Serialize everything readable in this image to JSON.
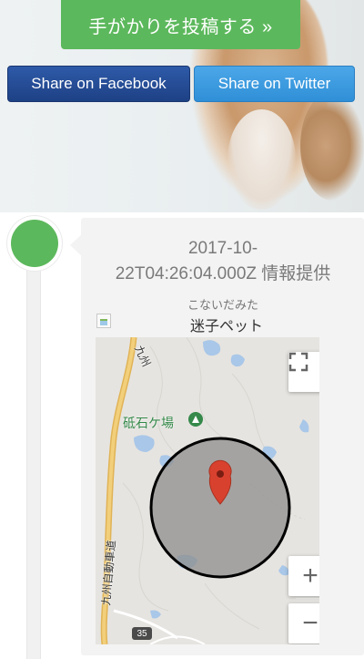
{
  "hero": {
    "post_button": "手がかりを投稿する »",
    "share_facebook": "Share on Facebook",
    "share_twitter": "Share on Twitter"
  },
  "timeline": {
    "timestamp_line1": "2017-10-",
    "timestamp_line2": "22T04:26:04.000Z 情報提供",
    "author": "こないだみた",
    "image_alt": "迷子ペット"
  },
  "map": {
    "place_label": "砥石ケ場",
    "road_label_top": "九州",
    "road_label_side": "九州自動車道",
    "route_number": "35",
    "fullscreen_icon": "fullscreen-icon",
    "zoom_in": "+",
    "zoom_out": "−"
  },
  "colors": {
    "primary_green": "#5cb85c",
    "facebook_blue": "#1e4185",
    "twitter_blue": "#2f8fd7",
    "marker_red": "#d9412f"
  }
}
